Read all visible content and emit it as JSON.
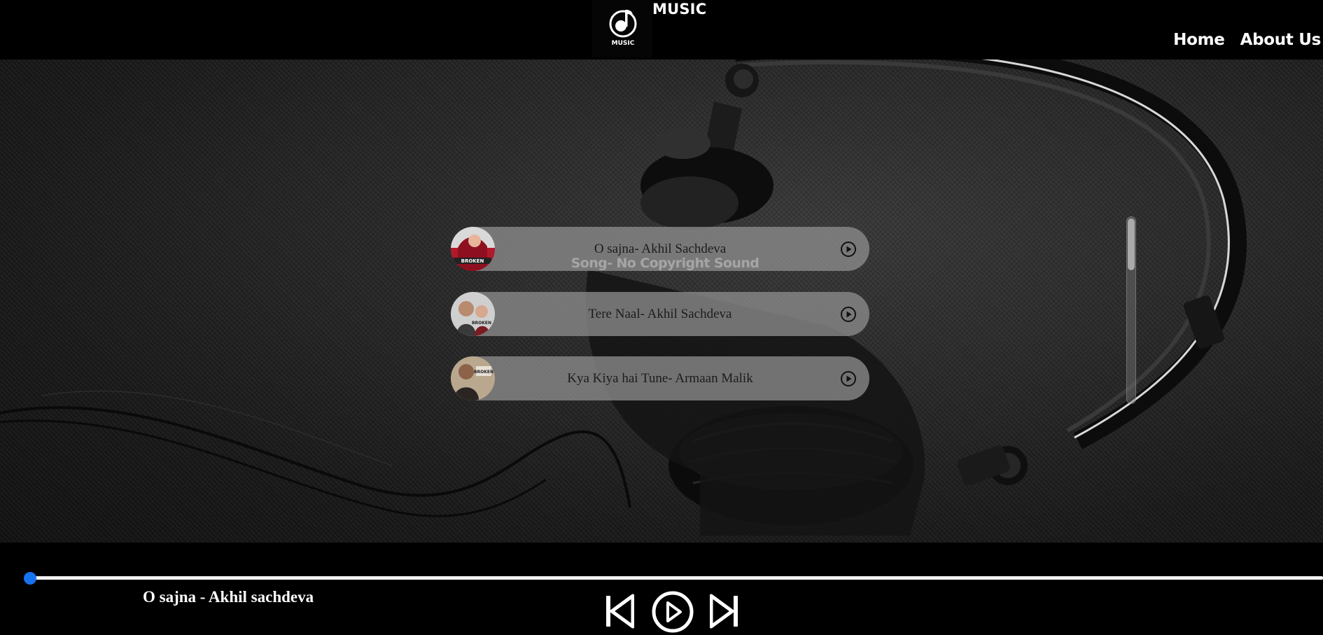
{
  "header": {
    "brand": "MUSIC",
    "logo_text": "MUSIC",
    "nav": [
      {
        "label": "Home"
      },
      {
        "label": "About Us"
      }
    ]
  },
  "main": {
    "list_title": "Song- No Copyright Sound",
    "songs": [
      {
        "title": "O sajna- Akhil Sachdeva",
        "cover_icon": "album-cover"
      },
      {
        "title": "Tere Naal- Akhil Sachdeva",
        "cover_icon": "album-cover"
      },
      {
        "title": "Kya Kiya hai Tune- Armaan Malik",
        "cover_icon": "album-cover"
      }
    ]
  },
  "player": {
    "now_playing": "O sajna - Akhil sachdeva",
    "progress": 0,
    "controls": [
      "previous-icon",
      "play-icon",
      "next-icon"
    ]
  },
  "colors": {
    "accent": "#1673f0",
    "item_bg": "#8c8c8c",
    "background": "#000000"
  }
}
